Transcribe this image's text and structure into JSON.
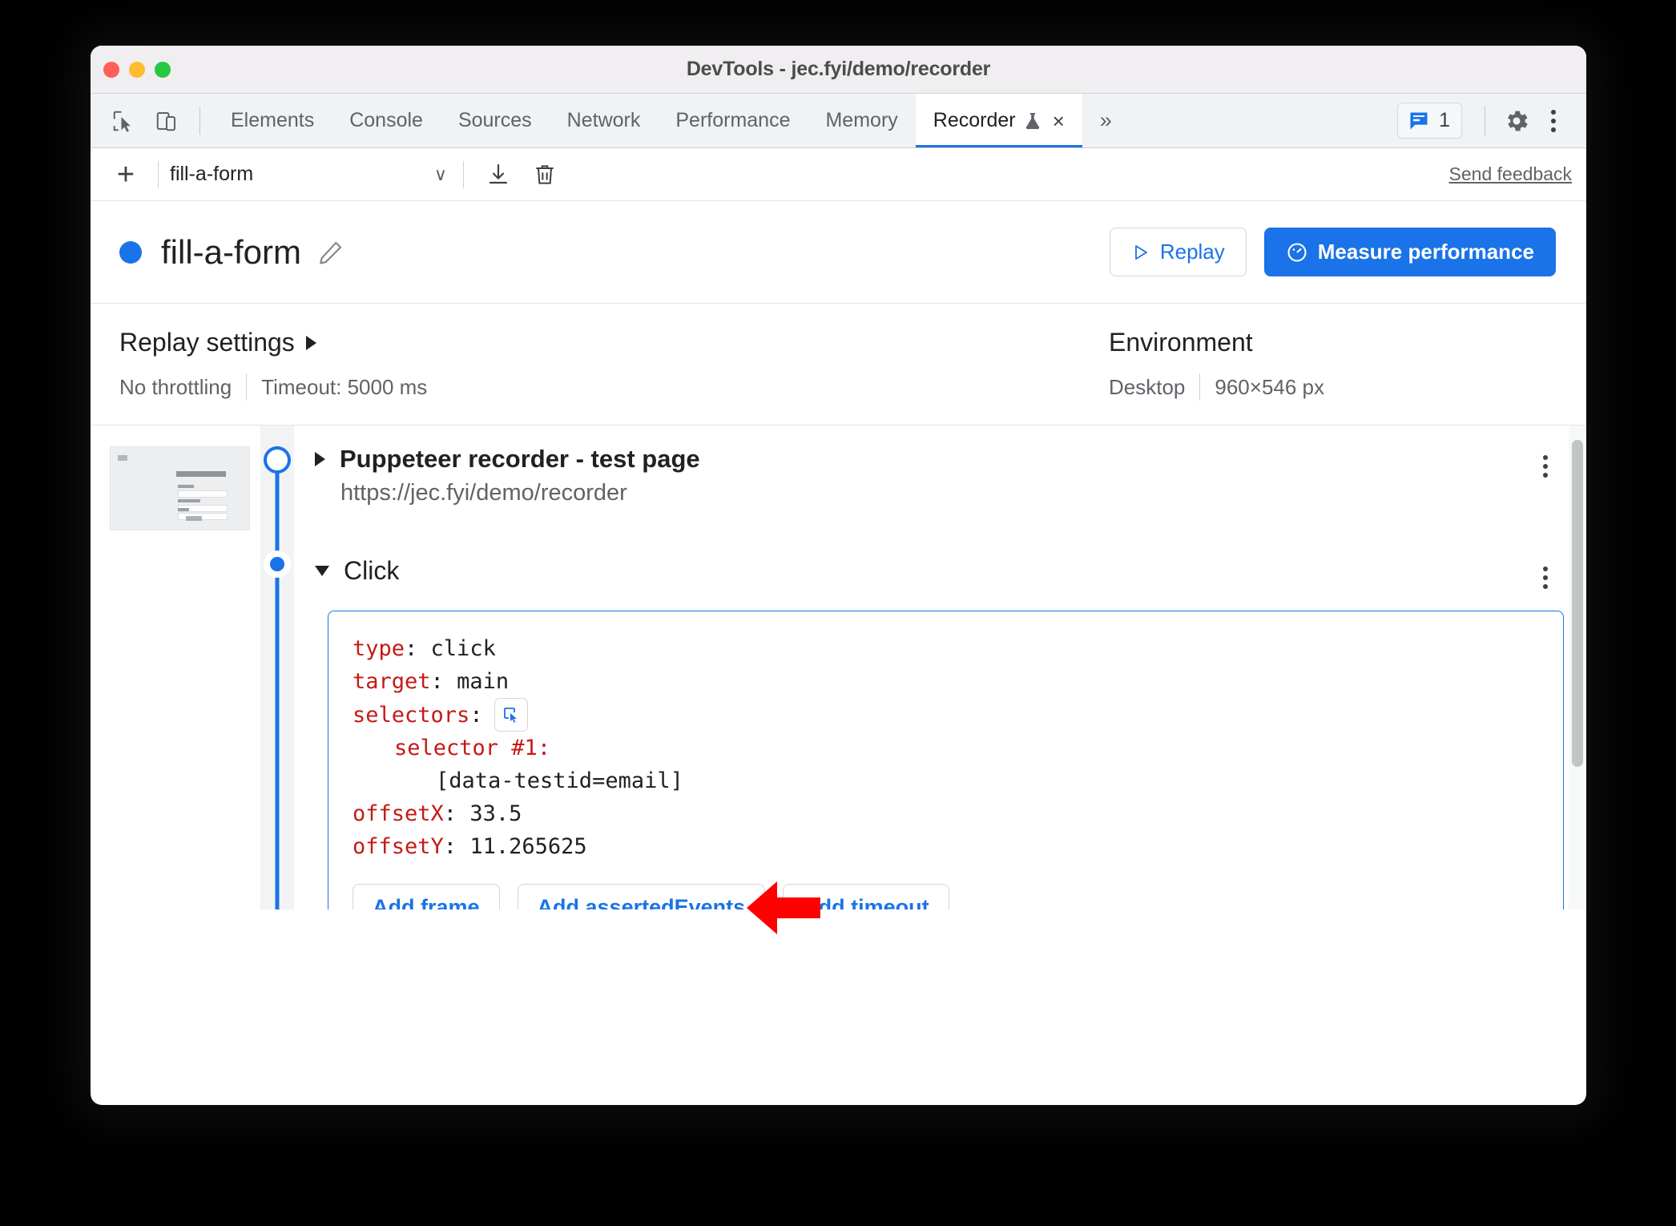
{
  "window": {
    "title": "DevTools - jec.fyi/demo/recorder",
    "traffic_lights": [
      "close",
      "minimize",
      "maximize"
    ]
  },
  "tabbar": {
    "inspect_icon": "inspect-cursor-icon",
    "device_icon": "device-toolbar-icon",
    "tabs": [
      {
        "label": "Elements",
        "active": false
      },
      {
        "label": "Console",
        "active": false
      },
      {
        "label": "Sources",
        "active": false
      },
      {
        "label": "Network",
        "active": false
      },
      {
        "label": "Performance",
        "active": false
      },
      {
        "label": "Memory",
        "active": false
      },
      {
        "label": "Recorder",
        "active": true,
        "experiment_icon": "flask-icon",
        "close_label": "×"
      }
    ],
    "more_tabs_label": "»",
    "messages_count": "1",
    "messages_icon": "message-icon",
    "settings_icon": "gear-icon",
    "more_icon": "kebab-menu-icon"
  },
  "recorder_toolbar": {
    "add_label": "+",
    "selected_recording": "fill-a-form",
    "caret": "∨",
    "export_icon": "download-icon",
    "delete_icon": "trash-icon",
    "feedback_label": "Send feedback"
  },
  "recording_header": {
    "status_dot_color": "#1a73e8",
    "name": "fill-a-form",
    "edit_icon": "pencil-icon",
    "replay_label": "Replay",
    "replay_icon": "play-triangle-icon",
    "measure_label": "Measure performance",
    "measure_icon": "performance-gauge-icon"
  },
  "settings": {
    "replay_settings_title": "Replay settings",
    "throttling": "No throttling",
    "timeout": "Timeout: 5000 ms",
    "environment_title": "Environment",
    "device": "Desktop",
    "viewport": "960×546 px"
  },
  "steps": [
    {
      "title": "Puppeteer recorder - test page",
      "url": "https://jec.fyi/demo/recorder",
      "expanded": false,
      "node": "hollow"
    },
    {
      "title": "Click",
      "expanded": true,
      "node": "filled",
      "code": [
        {
          "key": "type",
          "value": "click",
          "indent": 0
        },
        {
          "key": "target",
          "value": "main",
          "indent": 0
        },
        {
          "key": "selectors",
          "value": "",
          "indent": 0,
          "picker_icon": "selector-picker-icon"
        },
        {
          "key": "selector #1",
          "value": "",
          "indent": 1
        },
        {
          "key": "",
          "value": "[data-testid=email]",
          "indent": 2,
          "annotated": true
        },
        {
          "key": "offsetX",
          "value": "33.5",
          "indent": 0
        },
        {
          "key": "offsetY",
          "value": "11.265625",
          "indent": 0
        }
      ],
      "buttons": [
        "Add frame",
        "Add assertedEvents",
        "Add timeout"
      ]
    }
  ],
  "annotation": {
    "arrow_color": "#ff0000",
    "points_at": "[data-testid=email]"
  },
  "colors": {
    "accent": "#1a73e8",
    "key_red": "#c41a16",
    "annotation_red": "#ff0000",
    "text_primary": "#202124",
    "text_secondary": "#5f6368"
  }
}
